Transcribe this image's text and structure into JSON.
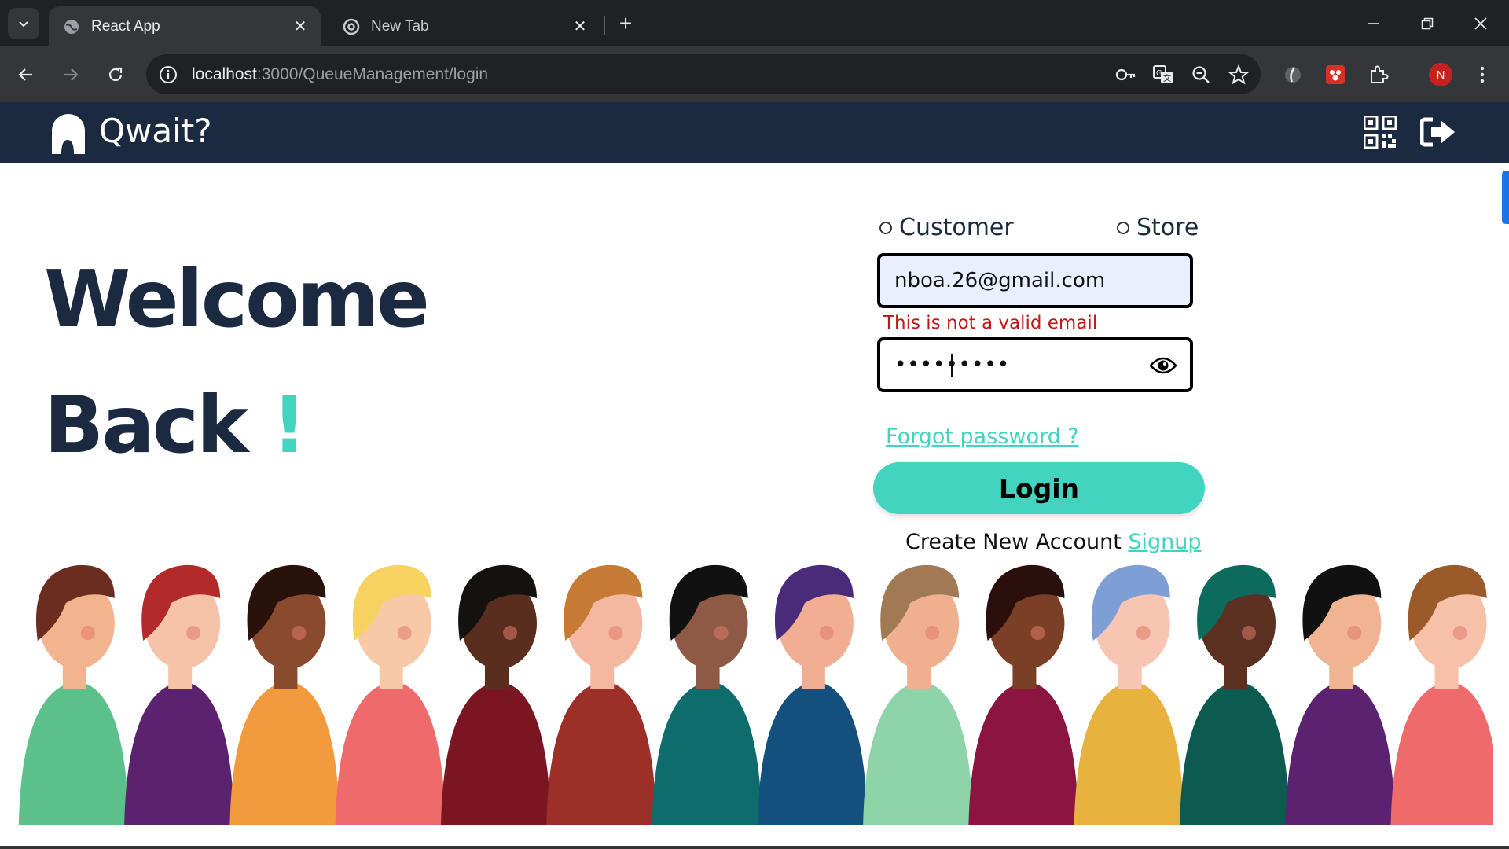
{
  "browser": {
    "tabs": [
      {
        "title": "React App",
        "active": true
      },
      {
        "title": "New Tab",
        "active": false
      }
    ],
    "url": {
      "host": "localhost",
      "path": ":3000/QueueManagement/login"
    },
    "profile_initial": "N"
  },
  "app": {
    "brand": "Qwait?",
    "welcome_line1": "Welcome",
    "welcome_line2": "Back",
    "welcome_bang": "!",
    "accent_color": "#42d4bf",
    "navy_color": "#1b2a40"
  },
  "login": {
    "role_options": [
      "Customer",
      "Store"
    ],
    "email_value": "nboa.26@gmail.com",
    "email_error": "This is not a valid email",
    "password_value": "•••••••••",
    "forgot_label": "Forgot password ?",
    "login_label": "Login",
    "create_account_text": "Create New Account",
    "signup_label": "Signup"
  },
  "icons": {
    "tab_search": "chevron-down-icon",
    "back": "arrow-left-icon",
    "forward": "arrow-right-icon",
    "reload": "reload-icon",
    "site_info": "info-icon",
    "password_manager": "key-icon",
    "translate": "translate-icon",
    "zoom": "zoom-icon",
    "bookmark": "star-icon",
    "qr": "qr-code-icon",
    "logout": "logout-icon",
    "show_password": "eye-icon"
  }
}
